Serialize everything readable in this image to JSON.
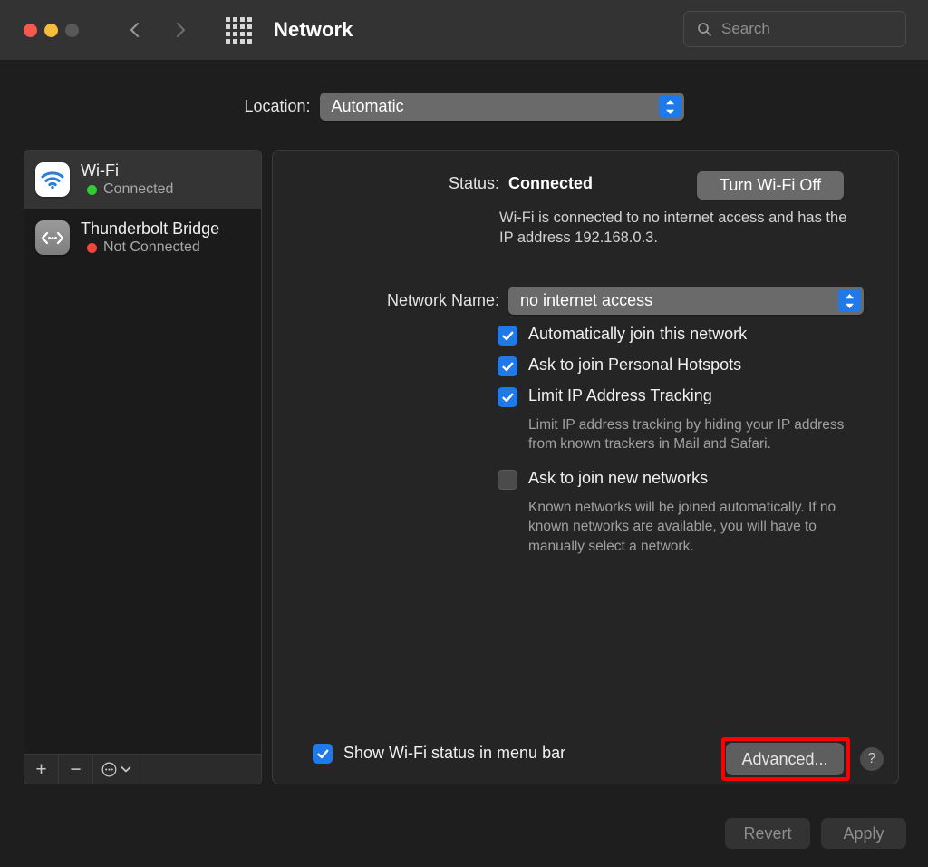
{
  "window": {
    "title": "Network",
    "traffic_lights": [
      "close",
      "minimize",
      "zoom"
    ],
    "back_icon": "chevron-left-icon",
    "forward_icon": "chevron-right-icon",
    "grid_icon": "grid-apps-icon"
  },
  "search": {
    "placeholder": "Search",
    "value": "",
    "icon": "search-icon"
  },
  "location": {
    "label": "Location:",
    "value": "Automatic",
    "options": [
      "Automatic"
    ]
  },
  "sidebar": {
    "items": [
      {
        "name": "Wi-Fi",
        "status": "Connected",
        "status_color": "#32cd32",
        "icon": "wifi-icon",
        "selected": true
      },
      {
        "name": "Thunderbolt Bridge",
        "status": "Not Connected",
        "status_color": "#f4453c",
        "icon": "thunderbolt-bridge-icon",
        "selected": false
      }
    ],
    "toolbar": {
      "add_label": "+",
      "remove_label": "−",
      "actions_icon": "ellipsis-circle-icon",
      "actions_chevron": "chevron-down-icon"
    }
  },
  "main": {
    "status_label": "Status:",
    "status_value": "Connected",
    "status_description": "Wi-Fi is connected to no internet access and has the IP address 192.168.0.3.",
    "turn_off_button": "Turn Wi-Fi Off",
    "network_name_label": "Network Name:",
    "network_name_value": "no internet access",
    "checkboxes": [
      {
        "label": "Automatically join this network",
        "checked": true,
        "help": ""
      },
      {
        "label": "Ask to join Personal Hotspots",
        "checked": true,
        "help": ""
      },
      {
        "label": "Limit IP Address Tracking",
        "checked": true,
        "help": "Limit IP address tracking by hiding your IP address from known trackers in Mail and Safari."
      },
      {
        "label": "Ask to join new networks",
        "checked": false,
        "help": "Known networks will be joined automatically. If no known networks are available, you will have to manually select a network."
      }
    ],
    "show_status_label": "Show Wi-Fi status in menu bar",
    "show_status_checked": true,
    "advanced_button": "Advanced...",
    "help_button": "?"
  },
  "footer": {
    "revert_label": "Revert",
    "apply_label": "Apply"
  },
  "highlight": {
    "color": "#ff0000",
    "target": "advanced-button"
  }
}
